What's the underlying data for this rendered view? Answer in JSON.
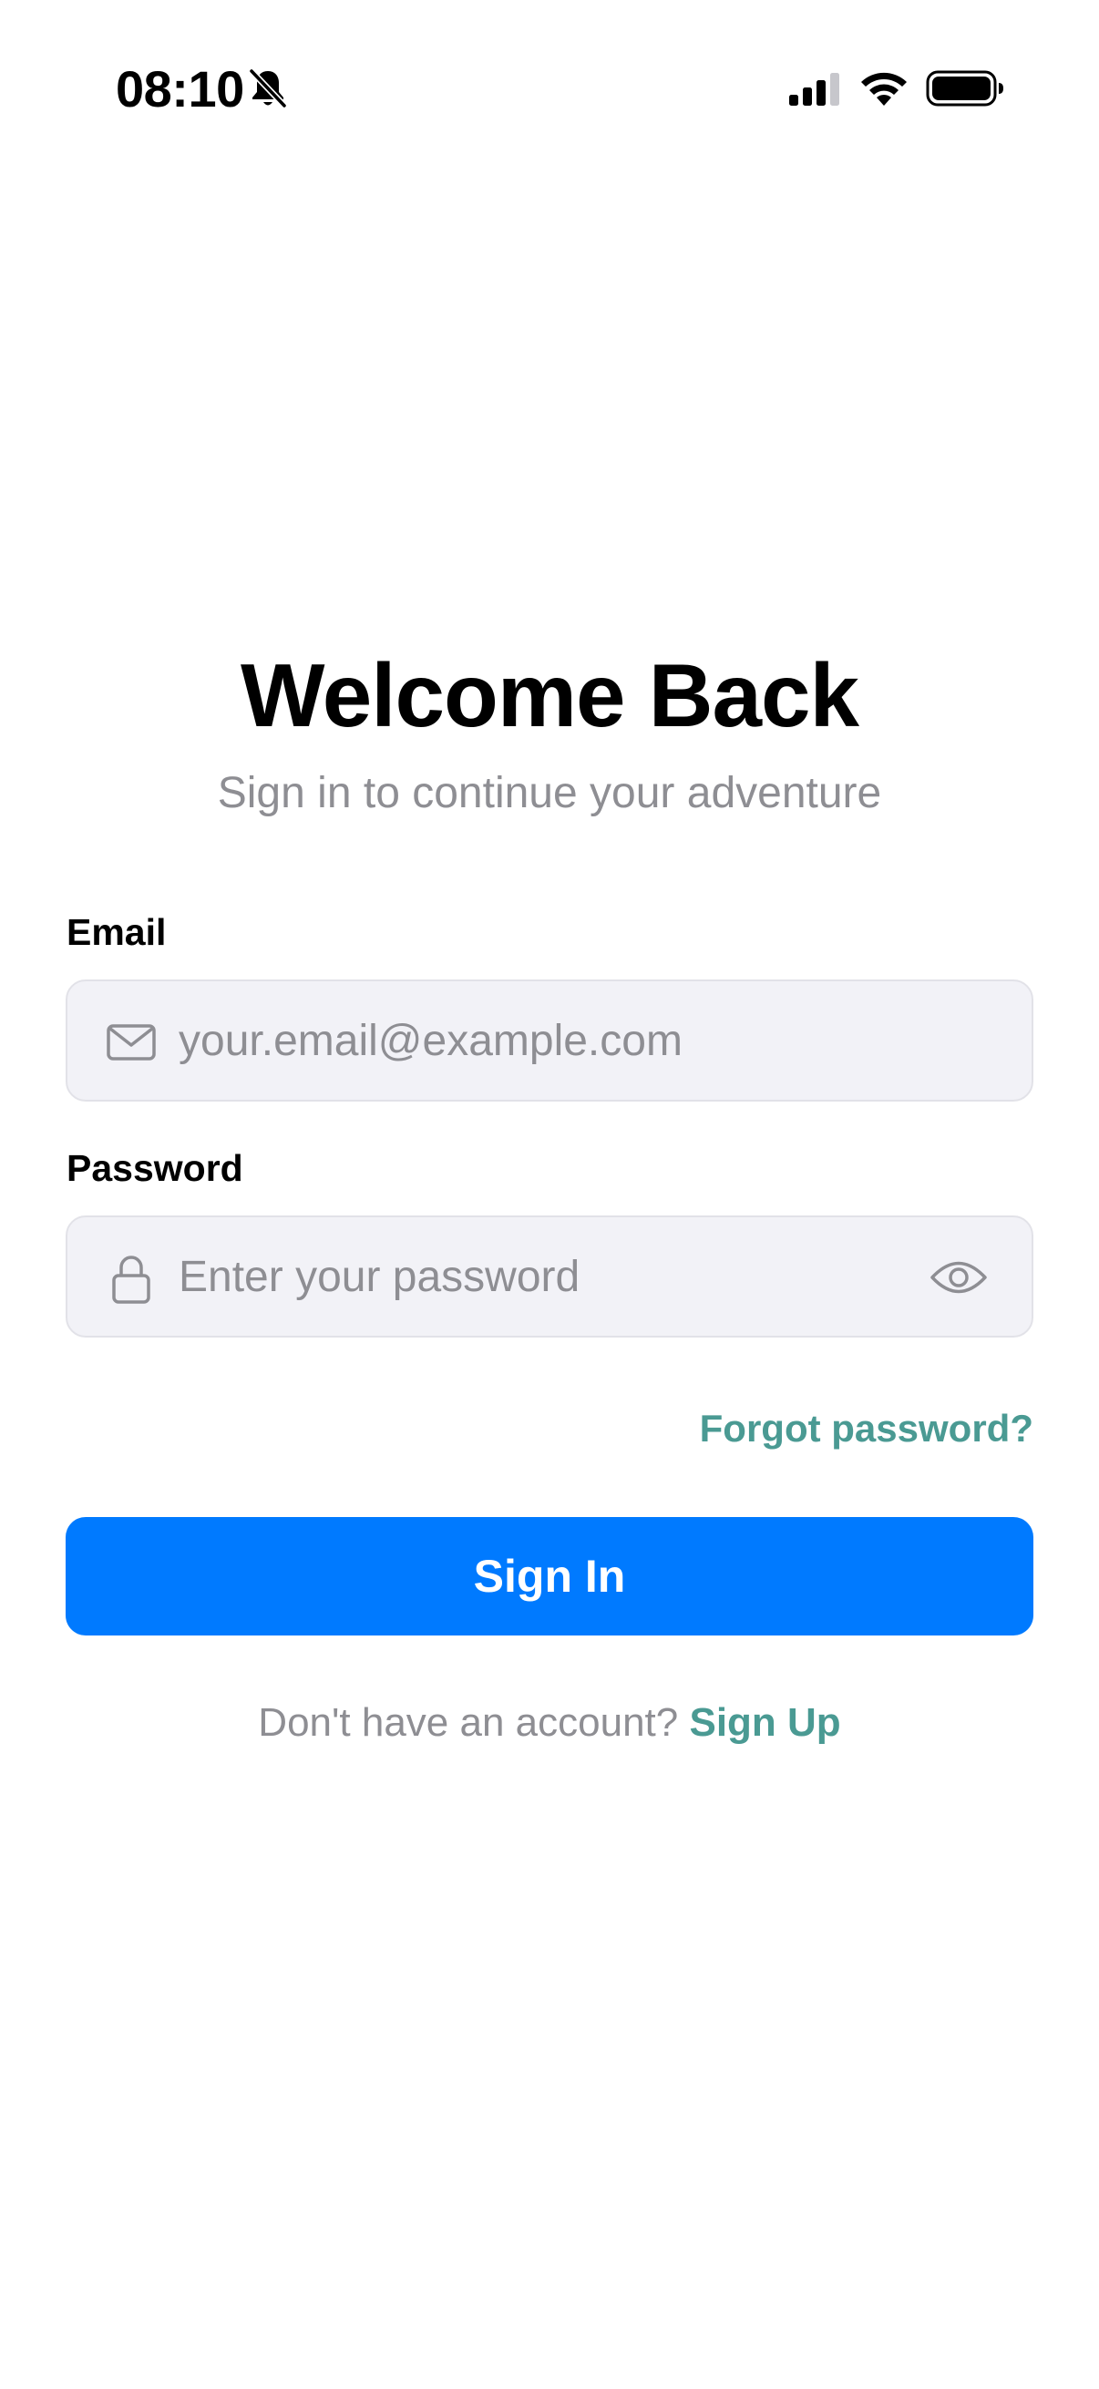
{
  "status_bar": {
    "time": "08:10",
    "icons": [
      "bell-slash-icon",
      "cellular-signal-icon",
      "wifi-icon",
      "battery-icon"
    ]
  },
  "header": {
    "title": "Welcome Back",
    "subtitle": "Sign in to continue your adventure"
  },
  "form": {
    "email": {
      "label": "Email",
      "placeholder": "your.email@example.com",
      "value": "",
      "icon": "envelope-icon"
    },
    "password": {
      "label": "Password",
      "placeholder": "Enter your password",
      "value": "",
      "icon": "lock-icon",
      "toggle_icon": "eye-icon"
    },
    "forgot_label": "Forgot password?",
    "submit_label": "Sign In"
  },
  "footer": {
    "prompt": "Don't have an account?",
    "link_label": "Sign Up"
  },
  "colors": {
    "primary": "#007aff",
    "link": "#4a9a93",
    "muted": "#8e8e93",
    "field_bg": "#f2f2f7"
  }
}
